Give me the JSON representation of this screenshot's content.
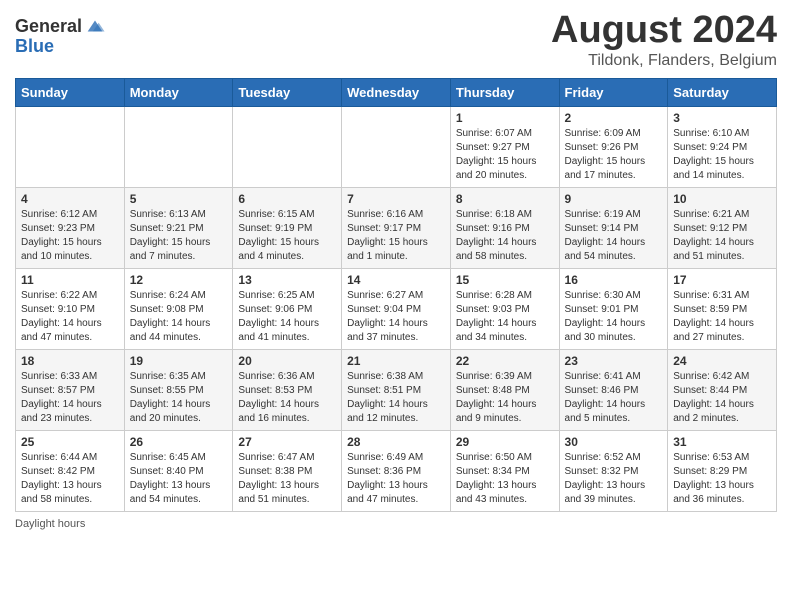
{
  "header": {
    "logo_general": "General",
    "logo_blue": "Blue",
    "title": "August 2024",
    "subtitle": "Tildonk, Flanders, Belgium"
  },
  "weekdays": [
    "Sunday",
    "Monday",
    "Tuesday",
    "Wednesday",
    "Thursday",
    "Friday",
    "Saturday"
  ],
  "weeks": [
    [
      {
        "day": "",
        "sunrise": "",
        "sunset": "",
        "daylight": ""
      },
      {
        "day": "",
        "sunrise": "",
        "sunset": "",
        "daylight": ""
      },
      {
        "day": "",
        "sunrise": "",
        "sunset": "",
        "daylight": ""
      },
      {
        "day": "",
        "sunrise": "",
        "sunset": "",
        "daylight": ""
      },
      {
        "day": "1",
        "sunrise": "Sunrise: 6:07 AM",
        "sunset": "Sunset: 9:27 PM",
        "daylight": "Daylight: 15 hours and 20 minutes."
      },
      {
        "day": "2",
        "sunrise": "Sunrise: 6:09 AM",
        "sunset": "Sunset: 9:26 PM",
        "daylight": "Daylight: 15 hours and 17 minutes."
      },
      {
        "day": "3",
        "sunrise": "Sunrise: 6:10 AM",
        "sunset": "Sunset: 9:24 PM",
        "daylight": "Daylight: 15 hours and 14 minutes."
      }
    ],
    [
      {
        "day": "4",
        "sunrise": "Sunrise: 6:12 AM",
        "sunset": "Sunset: 9:23 PM",
        "daylight": "Daylight: 15 hours and 10 minutes."
      },
      {
        "day": "5",
        "sunrise": "Sunrise: 6:13 AM",
        "sunset": "Sunset: 9:21 PM",
        "daylight": "Daylight: 15 hours and 7 minutes."
      },
      {
        "day": "6",
        "sunrise": "Sunrise: 6:15 AM",
        "sunset": "Sunset: 9:19 PM",
        "daylight": "Daylight: 15 hours and 4 minutes."
      },
      {
        "day": "7",
        "sunrise": "Sunrise: 6:16 AM",
        "sunset": "Sunset: 9:17 PM",
        "daylight": "Daylight: 15 hours and 1 minute."
      },
      {
        "day": "8",
        "sunrise": "Sunrise: 6:18 AM",
        "sunset": "Sunset: 9:16 PM",
        "daylight": "Daylight: 14 hours and 58 minutes."
      },
      {
        "day": "9",
        "sunrise": "Sunrise: 6:19 AM",
        "sunset": "Sunset: 9:14 PM",
        "daylight": "Daylight: 14 hours and 54 minutes."
      },
      {
        "day": "10",
        "sunrise": "Sunrise: 6:21 AM",
        "sunset": "Sunset: 9:12 PM",
        "daylight": "Daylight: 14 hours and 51 minutes."
      }
    ],
    [
      {
        "day": "11",
        "sunrise": "Sunrise: 6:22 AM",
        "sunset": "Sunset: 9:10 PM",
        "daylight": "Daylight: 14 hours and 47 minutes."
      },
      {
        "day": "12",
        "sunrise": "Sunrise: 6:24 AM",
        "sunset": "Sunset: 9:08 PM",
        "daylight": "Daylight: 14 hours and 44 minutes."
      },
      {
        "day": "13",
        "sunrise": "Sunrise: 6:25 AM",
        "sunset": "Sunset: 9:06 PM",
        "daylight": "Daylight: 14 hours and 41 minutes."
      },
      {
        "day": "14",
        "sunrise": "Sunrise: 6:27 AM",
        "sunset": "Sunset: 9:04 PM",
        "daylight": "Daylight: 14 hours and 37 minutes."
      },
      {
        "day": "15",
        "sunrise": "Sunrise: 6:28 AM",
        "sunset": "Sunset: 9:03 PM",
        "daylight": "Daylight: 14 hours and 34 minutes."
      },
      {
        "day": "16",
        "sunrise": "Sunrise: 6:30 AM",
        "sunset": "Sunset: 9:01 PM",
        "daylight": "Daylight: 14 hours and 30 minutes."
      },
      {
        "day": "17",
        "sunrise": "Sunrise: 6:31 AM",
        "sunset": "Sunset: 8:59 PM",
        "daylight": "Daylight: 14 hours and 27 minutes."
      }
    ],
    [
      {
        "day": "18",
        "sunrise": "Sunrise: 6:33 AM",
        "sunset": "Sunset: 8:57 PM",
        "daylight": "Daylight: 14 hours and 23 minutes."
      },
      {
        "day": "19",
        "sunrise": "Sunrise: 6:35 AM",
        "sunset": "Sunset: 8:55 PM",
        "daylight": "Daylight: 14 hours and 20 minutes."
      },
      {
        "day": "20",
        "sunrise": "Sunrise: 6:36 AM",
        "sunset": "Sunset: 8:53 PM",
        "daylight": "Daylight: 14 hours and 16 minutes."
      },
      {
        "day": "21",
        "sunrise": "Sunrise: 6:38 AM",
        "sunset": "Sunset: 8:51 PM",
        "daylight": "Daylight: 14 hours and 12 minutes."
      },
      {
        "day": "22",
        "sunrise": "Sunrise: 6:39 AM",
        "sunset": "Sunset: 8:48 PM",
        "daylight": "Daylight: 14 hours and 9 minutes."
      },
      {
        "day": "23",
        "sunrise": "Sunrise: 6:41 AM",
        "sunset": "Sunset: 8:46 PM",
        "daylight": "Daylight: 14 hours and 5 minutes."
      },
      {
        "day": "24",
        "sunrise": "Sunrise: 6:42 AM",
        "sunset": "Sunset: 8:44 PM",
        "daylight": "Daylight: 14 hours and 2 minutes."
      }
    ],
    [
      {
        "day": "25",
        "sunrise": "Sunrise: 6:44 AM",
        "sunset": "Sunset: 8:42 PM",
        "daylight": "Daylight: 13 hours and 58 minutes."
      },
      {
        "day": "26",
        "sunrise": "Sunrise: 6:45 AM",
        "sunset": "Sunset: 8:40 PM",
        "daylight": "Daylight: 13 hours and 54 minutes."
      },
      {
        "day": "27",
        "sunrise": "Sunrise: 6:47 AM",
        "sunset": "Sunset: 8:38 PM",
        "daylight": "Daylight: 13 hours and 51 minutes."
      },
      {
        "day": "28",
        "sunrise": "Sunrise: 6:49 AM",
        "sunset": "Sunset: 8:36 PM",
        "daylight": "Daylight: 13 hours and 47 minutes."
      },
      {
        "day": "29",
        "sunrise": "Sunrise: 6:50 AM",
        "sunset": "Sunset: 8:34 PM",
        "daylight": "Daylight: 13 hours and 43 minutes."
      },
      {
        "day": "30",
        "sunrise": "Sunrise: 6:52 AM",
        "sunset": "Sunset: 8:32 PM",
        "daylight": "Daylight: 13 hours and 39 minutes."
      },
      {
        "day": "31",
        "sunrise": "Sunrise: 6:53 AM",
        "sunset": "Sunset: 8:29 PM",
        "daylight": "Daylight: 13 hours and 36 minutes."
      }
    ]
  ],
  "footer": {
    "note": "Daylight hours"
  }
}
